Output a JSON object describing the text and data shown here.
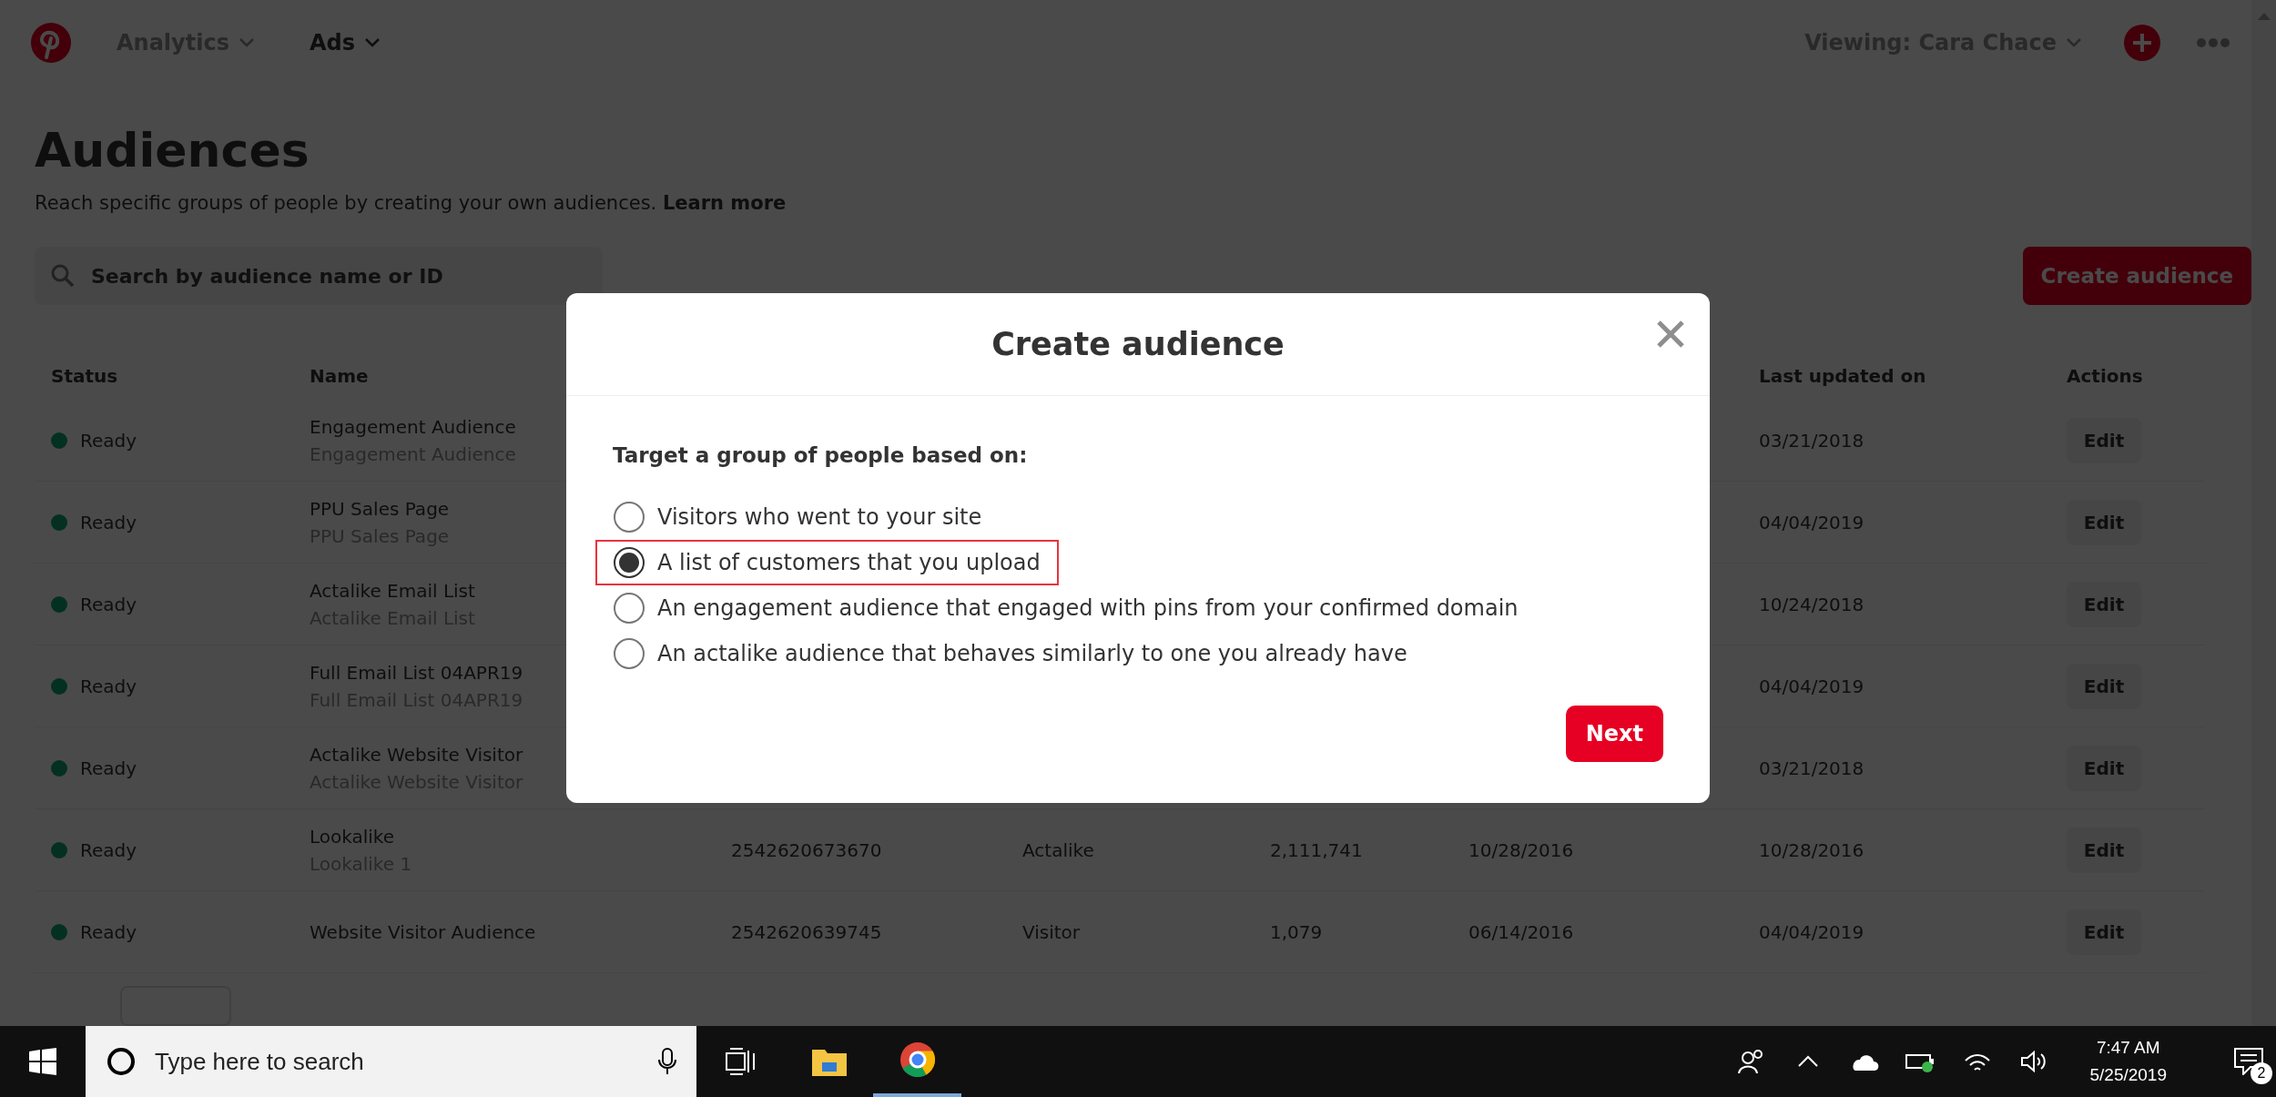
{
  "nav": {
    "items": [
      {
        "label": "Analytics",
        "selected": false
      },
      {
        "label": "Ads",
        "selected": true
      }
    ],
    "account": "Viewing: Cara Chace"
  },
  "page": {
    "title": "Audiences",
    "subtitle": "Reach specific groups of people by creating your own audiences.",
    "learn_more": "Learn more",
    "search": {
      "placeholder": "Search by audience name or ID"
    },
    "create_button": "Create audience"
  },
  "table": {
    "columns": [
      "Status",
      "Name",
      "Last updated on",
      "Actions"
    ],
    "rows": [
      {
        "status": "Ready",
        "name": "Engagement Audience",
        "subname": "Engagement Audience",
        "last_updated": "03/21/2018",
        "action": "Edit"
      },
      {
        "status": "Ready",
        "name": "PPU Sales Page",
        "subname": "PPU Sales Page",
        "last_updated": "04/04/2019",
        "action": "Edit"
      },
      {
        "status": "Ready",
        "name": "Actalike Email List",
        "subname": "Actalike Email List",
        "last_updated": "10/24/2018",
        "action": "Edit"
      },
      {
        "status": "Ready",
        "name": "Full Email List 04APR19",
        "subname": "Full Email List 04APR19",
        "last_updated": "04/04/2019",
        "action": "Edit"
      },
      {
        "status": "Ready",
        "name": "Actalike Website Visitor",
        "subname": "Actalike Website Visitor",
        "last_updated": "03/21/2018",
        "action": "Edit"
      },
      {
        "status": "Ready",
        "name": "Lookalike",
        "subname": "Lookalike 1",
        "audience_id": "2542620673670",
        "type": "Actalike",
        "size": "2,111,741",
        "created_on": "10/28/2016",
        "last_updated": "10/28/2016",
        "action": "Edit"
      },
      {
        "status": "Ready",
        "name": "Website Visitor Audience",
        "audience_id": "2542620639745",
        "type": "Visitor",
        "size": "1,079",
        "created_on": "06/14/2016",
        "last_updated": "04/04/2019",
        "action": "Edit"
      }
    ]
  },
  "modal": {
    "title": "Create audience",
    "prompt": "Target a group of people based on:",
    "options": [
      {
        "label": "Visitors who went to your site",
        "selected": false,
        "highlighted": false
      },
      {
        "label": "A list of customers that you upload",
        "selected": true,
        "highlighted": true
      },
      {
        "label": "An engagement audience that engaged with pins from your confirmed domain",
        "selected": false,
        "highlighted": false
      },
      {
        "label": "An actalike audience that behaves similarly to one you already have",
        "selected": false,
        "highlighted": false
      }
    ],
    "next_button": "Next"
  },
  "taskbar": {
    "search_placeholder": "Type here to search",
    "time": "7:47 AM",
    "date": "5/25/2019",
    "notification_count": "2"
  }
}
